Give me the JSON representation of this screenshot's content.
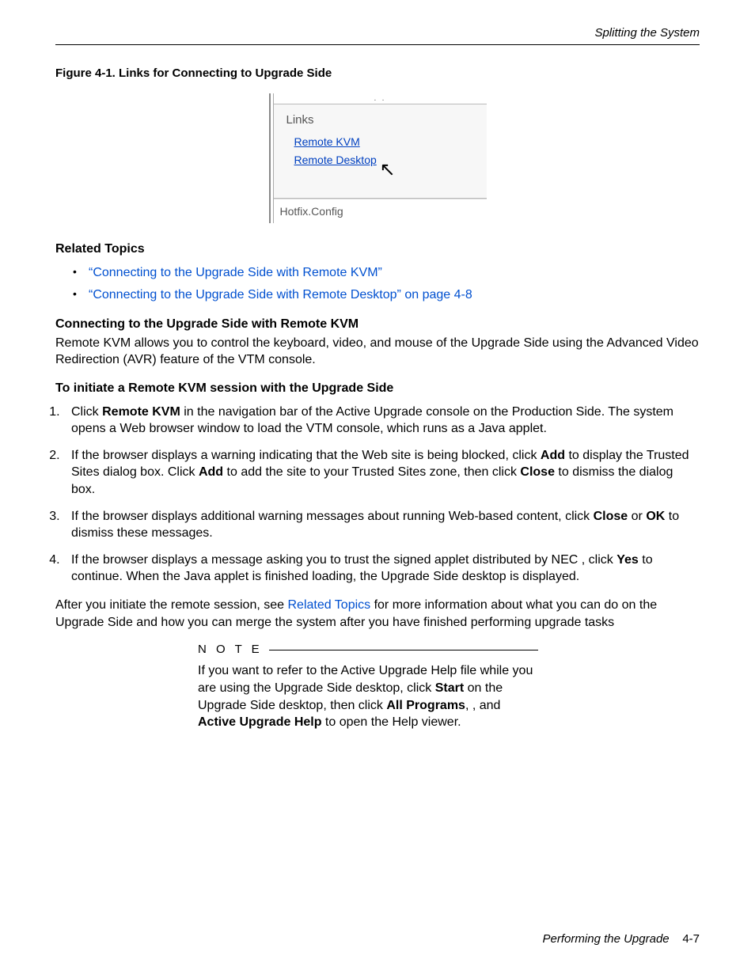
{
  "header": {
    "rightTitle": "Splitting the System"
  },
  "figure": {
    "caption": "Figure 4-1. Links for Connecting to Upgrade Side",
    "linksHeading": "Links",
    "link1": "Remote KVM",
    "link2": "Remote Desktop",
    "status": "Hotfix.Config"
  },
  "relatedTopics": {
    "heading": "Related Topics",
    "items": [
      "“Connecting to the Upgrade Side with Remote KVM”",
      "“Connecting to the Upgrade Side with Remote Desktop” on page 4-8"
    ]
  },
  "s1": {
    "heading": "Connecting to the Upgrade Side with Remote KVM",
    "para": "Remote KVM allows you to control the keyboard, video, and mouse of the Upgrade Side using the Advanced Video Redirection (AVR) feature of the VTM console."
  },
  "s2": {
    "heading": "To initiate a Remote KVM session with the Upgrade Side",
    "step1a": "Click ",
    "step1b": "Remote KVM",
    "step1c": " in the navigation bar of the Active Upgrade console on the Production Side. The system opens a Web browser window to load the VTM console, which runs as a Java applet.",
    "step2a": "If the browser displays a warning indicating that the Web site is being blocked, click ",
    "step2b": "Add",
    "step2c": " to display the Trusted Sites dialog box. Click ",
    "step2d": "Add",
    "step2e": " to add the site to your Trusted Sites zone, then click ",
    "step2f": "Close",
    "step2g": " to dismiss the dialog box.",
    "step3a": "If the browser displays additional warning messages about running Web-based content, click ",
    "step3b": "Close",
    "step3c": " or ",
    "step3d": "OK",
    "step3e": " to dismiss these messages.",
    "step4a": "If the browser displays a message asking you to trust the signed applet distributed by NEC                                           , click ",
    "step4b": "Yes",
    "step4c": " to continue. When the Java applet is finished loading, the Upgrade Side desktop is displayed."
  },
  "after": {
    "a": "After you initiate the remote session, see ",
    "link": "Related Topics",
    "b": " for more information about what you can do on the Upgrade Side and how you can merge the system after you have finished performing upgrade tasks"
  },
  "note": {
    "label": "N O T E",
    "l1": "If you want to refer to the Active Upgrade Help file while you are using the Upgrade Side desktop, click ",
    "b1": "Start",
    "l2": " on the Upgrade Side desktop, then click ",
    "b2": "All Programs",
    "l3": ",          , and ",
    "b3": "Active Upgrade Help",
    "l4": " to open the Help viewer."
  },
  "footer": {
    "title": "Performing the Upgrade",
    "page": "4-7"
  }
}
